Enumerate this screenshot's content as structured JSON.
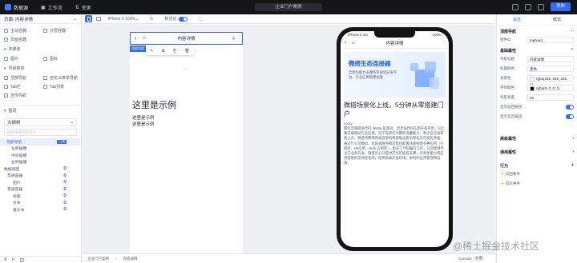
{
  "topbar": {
    "logo": "数据源",
    "workbench": "工作流",
    "sync": "变更",
    "title": "企业门户案例",
    "publish": "发布"
  },
  "left": {
    "page_select": "页面: 内容详情",
    "sec_containers": "容器",
    "containers": [
      "主动容器",
      "分层容器",
      "页面容器"
    ],
    "sec_media": "多媒体",
    "media": [
      "图片",
      "图标"
    ],
    "sec_nav": "导航菜单",
    "nav": [
      "顶部导航",
      "自定义菜单导航",
      "Tab栏",
      "Tab列表",
      "宣传导航"
    ],
    "sec_layers": "图层",
    "layer_select": "大纲树",
    "search_ph": "搜索组件名称或ID",
    "tree": [
      {
        "label": "顶部导航",
        "badge": "已选",
        "active": true,
        "indent": 8
      },
      {
        "label": "左侧插槽",
        "indent": 14
      },
      {
        "label": "中间插槽",
        "indent": 14
      },
      {
        "label": "右侧插槽",
        "indent": 14
      },
      {
        "label": "数据视图",
        "d": "D",
        "indent": 5
      },
      {
        "label": "普通容器",
        "d": "D",
        "indent": 9
      },
      {
        "label": "图片",
        "d": "D",
        "indent": 16
      },
      {
        "label": "普通容器",
        "d": "D",
        "indent": 9
      },
      {
        "label": "标题",
        "d": "D",
        "indent": 16
      },
      {
        "label": "文本",
        "d": "D",
        "indent": 16
      },
      {
        "label": "富文本",
        "d": "D",
        "indent": 16
      }
    ]
  },
  "toolbar": {
    "device": "iPhone 6 100%",
    "toggle_label": "新式化"
  },
  "page": {
    "nav_title": "内容详情",
    "tag": "顶部导航",
    "sample_h": "这里是示例",
    "sample1": "这里是示例",
    "sample2": "这里是示例"
  },
  "phone": {
    "status_left": "iPhone 6 4G",
    "time": "11:24",
    "battery": "100%",
    "nav_title": "内容详情",
    "banner_title": "微搭生态连接器",
    "banner_text": "云原生能力支撑的可视化开发平台，行业应用搭建加速",
    "article_title": "微搭场景化上线，5分钟从零搭建门户",
    "author": "rocky",
    "article_body": "腾讯云微搭低代码 WeDa 是高效、灵活低代码应用开发平台，同上集前端调动行业应用。向下连接云计算的海量能力，和企业信息系统上云。微搭将繁琐的底层架构和基础设施治理化为可视化界面，通过什么可模拟，也就式组件和可指化配置快速构建多种应用（小程序、H5应用、Web 应用等），免去了代码编写工作，让您能够专注于业务开发。微搭云公开提供完全的底层支撑，云原生能力将应用搭建的全局程化的，提供高级开放环境，即时的应用管理和运维。"
  },
  "right": {
    "tab_props": "属性",
    "tab_style": "样式",
    "comp_name": "顶部导航",
    "comp_id_label": "组件ID",
    "comp_id": "topNav1",
    "sec_basic": "基础属性",
    "props": [
      {
        "label": "导航标题",
        "value": "内容详情"
      },
      {
        "label": "标题颜色",
        "value": "黑色"
      },
      {
        "label": "背景色",
        "value": "rgba(255, 255, 255, 1)",
        "color": "#ffffff"
      },
      {
        "label": "字体颜色",
        "value": "rgba(0, 0, 0, 1)",
        "color": "#000000"
      },
      {
        "label": "导航高度",
        "value": "26"
      }
    ],
    "switches": [
      "显示返回按钮",
      "显示首页按钮"
    ],
    "sec_adv": "高级属性",
    "sec_general": "通用属性",
    "sec_actions": "行为",
    "action1": "返回事件",
    "action2": "首页事件"
  },
  "bottom": {
    "crumb1": "企业门户案例",
    "crumb2": "内容详情",
    "console": "Console",
    "count": "0 条"
  },
  "watermark": "@稀土掘金技术社区"
}
